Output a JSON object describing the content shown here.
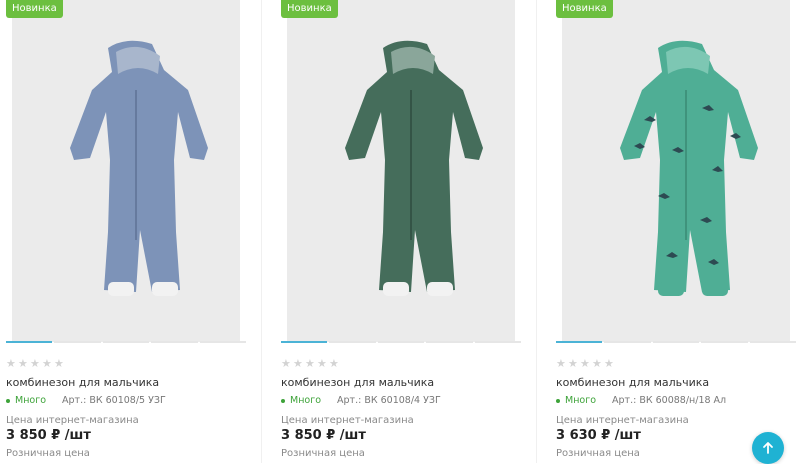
{
  "products": [
    {
      "badge": "Новинка",
      "name": "комбинезон для мальчика",
      "stock": "Много",
      "article": "Арт.: ВК 60108/5 УЗГ",
      "price_label": "Цена интернет-магазина",
      "price": "3 850 ₽ /шт",
      "retail_label": "Розничная цена",
      "rating": "0 of 5",
      "color": "#7d93b8",
      "color_dark": "#6a80a5"
    },
    {
      "badge": "Новинка",
      "name": "комбинезон для мальчика",
      "stock": "Много",
      "article": "Арт.: ВК 60108/4 УЗГ",
      "price_label": "Цена интернет-магазина",
      "price": "3 850 ₽ /шт",
      "retail_label": "Розничная цена",
      "rating": "0 of 5",
      "color": "#456d5b",
      "color_dark": "#375a4a"
    },
    {
      "badge": "Новинка",
      "name": "комбинезон для мальчика",
      "stock": "Много",
      "article": "Арт.: ВК 60088/н/18 Ал",
      "price_label": "Цена интернет-магазина",
      "price": "3 630 ₽ /шт",
      "retail_label": "Розничная цена",
      "rating": "0 of 5",
      "color": "#4fae95",
      "color_dark": "#3f9580"
    }
  ],
  "scroll_top": {
    "icon": "arrow-up-icon"
  },
  "colors": {
    "badge": "#6cbf3f",
    "accent": "#1fb2d3",
    "stock": "#3ea33a"
  }
}
